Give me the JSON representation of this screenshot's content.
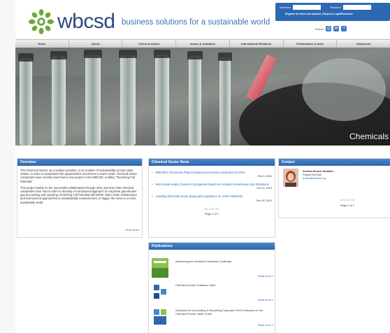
{
  "brand": {
    "logo_text": "wbcsd",
    "tagline": "business solutions for a sustainable world",
    "brand_color": "#2b4c7e",
    "accent_color": "#3c72b5"
  },
  "login": {
    "username_label": "Username",
    "password_label": "Password",
    "links": "Register for News and Updates  |  Request Login/Password"
  },
  "toolbar": {
    "label": "Toolbar",
    "buttons": [
      "print-icon",
      "email-icon",
      "add-icon"
    ]
  },
  "nav": {
    "items": [
      "Home",
      "About",
      "Vision to Action",
      "Issues & Solutions",
      "International Relations",
      "Publications & tools",
      "Newsroom"
    ]
  },
  "banner": {
    "caption": "Chemicals"
  },
  "overview": {
    "title": "Overview",
    "p1": "The Chemical Sector, as a solution provider, is an enabler of sustainability across value chains. In order to understand the opportunities and levers to reach scale, chemical sector companies have recently launched a new project in the WBCSD, entitled, \"Reaching Full Potential\".",
    "p2": "This project builds on the successful collaboration through 2011 and 2012 that chemical companies have had in order to develop a harmonized approach to corporate greenhouse gas accounting and reporting. Reaching Full Potential will further value chain collaboration and harmonized approaches to sustainability measurement, to trigger the move to a more sustainable world.",
    "read_more": "Read more"
  },
  "news": {
    "title": "Chemical Sector News",
    "items": [
      {
        "title": "WBCSD's Chemicals Project advances innovative work plan for 2014",
        "date": "Feb 6, 2014"
      },
      {
        "title": "New Guide Helps Chemical Companies Report on Avoided Greenhouse Gas Emissions",
        "date": "Oct 21, 2013"
      },
      {
        "title": "Leading chemicals sector group gives guidance on GHG emissions",
        "date": "Feb 26, 2013"
      }
    ],
    "pager_nav": "<< < 1 > >>",
    "pager_text": "Page 1 of 1"
  },
  "contact": {
    "title": "Contact",
    "name": "Andrea Brown Smalian",
    "role": "Project Director",
    "email": "brown@wbcsd.org",
    "pager_nav": "<< < 1 > >>",
    "pager_text": "Page 1 of 1"
  },
  "publications": {
    "title": "Publications",
    "items": [
      {
        "title": "Addressing the Avoided Emissions Challenge",
        "read_more": "Read more »"
      },
      {
        "title": "Chemical Sector Guidance Q&A",
        "read_more": "Read more »"
      },
      {
        "title": "Guidance for Accounting & Reporting Corporate GHG Emissions in the Chemical Sector Value Chain",
        "read_more": "Read more »"
      }
    ]
  }
}
